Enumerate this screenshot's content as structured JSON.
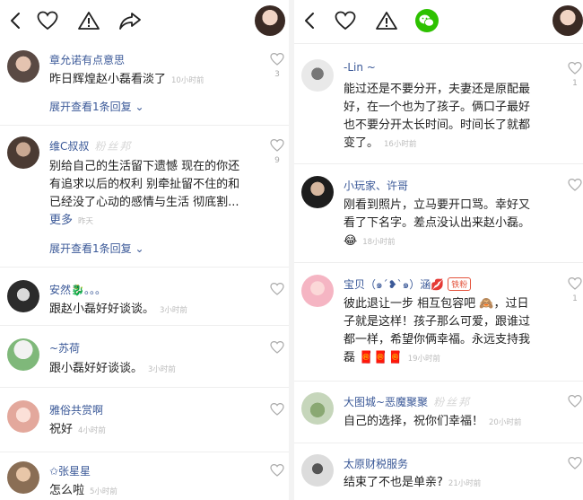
{
  "left": {
    "comments": [
      {
        "username": "章允诺有点意思",
        "text": "昨日辉煌赵小磊看淡了",
        "time": "10小时前",
        "likes": "3",
        "expand": "展开查看1条回复"
      },
      {
        "username": "维C叔叔",
        "watermark": "粉丝邦",
        "text_lines": [
          "别给自己的生活留下遗憾 现在的你还",
          "有追求以后的权利 别牵扯留不住的和",
          "已经没了心动的感情与生活 彻底割..."
        ],
        "more": "更多",
        "time": "昨天",
        "likes": "9",
        "expand": "展开查看1条回复"
      },
      {
        "username": "安然🐉。。。",
        "text": "跟赵小磊好好谈谈。",
        "time": "3小时前"
      },
      {
        "username": "~苏荷",
        "text": "跟小磊好好谈谈。",
        "time": "3小时前"
      },
      {
        "username": "雅俗共赏啊",
        "text": "祝好",
        "time": "4小时前"
      },
      {
        "username": "✩张星星",
        "text": "怎么啦",
        "time": "5小时前"
      }
    ]
  },
  "right": {
    "comments": [
      {
        "username": "-Lin ~",
        "text_lines": [
          "能过还是不要分开，夫妻还是原配最",
          "好，在一个也为了孩子。俩口子最好",
          "也不要分开太长时间。时间长了就都",
          "变了。"
        ],
        "time": "16小时前",
        "likes": "1"
      },
      {
        "username": "小玩家、许哥",
        "text_lines": [
          "刚看到照片，立马要开口骂。幸好又",
          "看了下名字。差点没认出来赵小磊。"
        ],
        "emoji": "😂",
        "time": "18小时前"
      },
      {
        "username": "宝贝（๑´❥`๑）涵💋",
        "badge": "铁粉",
        "text_lines": [
          "彼此退让一步 相互包容吧 🙈，过日",
          "子就是这样！孩子那么可爱，跟谁过",
          "都一样，希望你俩幸福。永远支持我"
        ],
        "last_line": "磊 🧧🧧🧧",
        "time": "19小时前",
        "likes": "1"
      },
      {
        "username": "大图城~恶魔聚聚",
        "watermark": "粉丝邦",
        "text": "自己的选择，祝你们幸福！",
        "time": "20小时前"
      },
      {
        "username": "太原财税服务",
        "text": "结束了不也是单亲?",
        "time": "21小时前"
      }
    ]
  },
  "colors": {
    "link": "#3b5998",
    "wechat": "#2dc100",
    "badge": "#e4533c"
  },
  "icons": [
    "back-icon",
    "heart-icon",
    "warning-icon",
    "share-icon",
    "wechat-icon"
  ]
}
